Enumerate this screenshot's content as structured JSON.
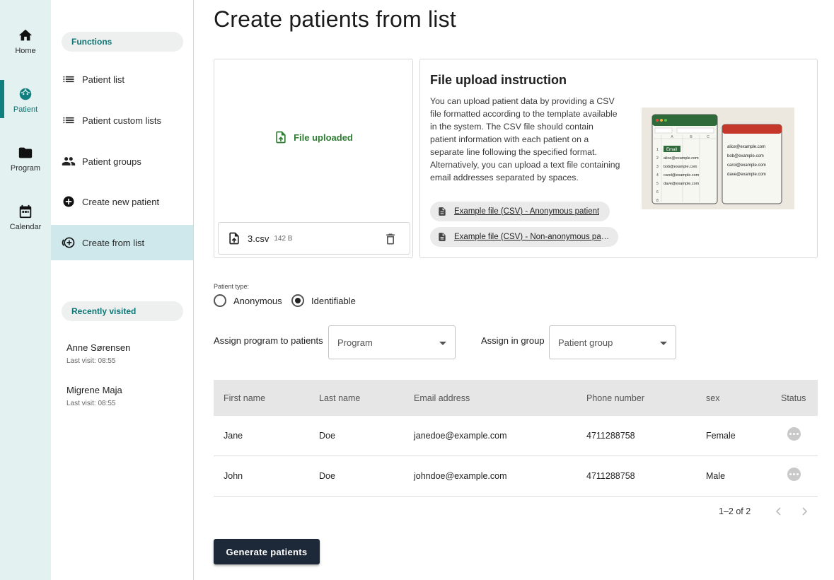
{
  "rail": [
    {
      "label": "Home",
      "icon": "home-icon"
    },
    {
      "label": "Patient",
      "icon": "face-icon"
    },
    {
      "label": "Program",
      "icon": "folder-icon"
    },
    {
      "label": "Calendar",
      "icon": "calendar-icon"
    }
  ],
  "subnav": {
    "functions_header": "Functions",
    "items": [
      {
        "label": "Patient list",
        "icon": "list-icon"
      },
      {
        "label": "Patient custom lists",
        "icon": "list-icon"
      },
      {
        "label": "Patient groups",
        "icon": "people-icon"
      },
      {
        "label": "Create new patient",
        "icon": "add-circle-icon"
      },
      {
        "label": "Create from list",
        "icon": "add-list-icon"
      }
    ],
    "recent_header": "Recently visited",
    "recent": [
      {
        "name": "Anne Sørensen",
        "time": "Last visit: 08:55"
      },
      {
        "name": "Migrene Maja",
        "time": "Last visit: 08:55"
      }
    ]
  },
  "page": {
    "title": "Create patients from list"
  },
  "upload": {
    "status": "File uploaded",
    "file_name": "3.csv",
    "file_size": "142 B"
  },
  "instructions": {
    "title": "File upload instruction",
    "text": "You can upload patient data by providing a CSV file formatted according to the template available in the system. The CSV file should contain patient information with each patient on a separate line following the specified format. Alternatively, you can upload a text file containing email addresses separated by spaces.",
    "links": [
      "Example file (CSV) - Anonymous patient",
      "Example file (CSV) - Non-anonymous patient"
    ],
    "illustration": {
      "sheet_header": "Email",
      "sheet_rows": [
        "1",
        "2",
        "3",
        "4",
        "5",
        "6",
        "8"
      ],
      "sheet_cols": [
        "A",
        "B",
        "C"
      ],
      "emails": [
        "alice@example.com",
        "bob@example.com",
        "carol@example.com",
        "dave@example.com"
      ]
    }
  },
  "form": {
    "patient_type_label": "Patient type:",
    "options": [
      "Anonymous",
      "Identifiable"
    ],
    "selected": "Identifiable",
    "program_label": "Assign program to patients",
    "program_placeholder": "Program",
    "group_label": "Assign in group",
    "group_placeholder": "Patient group"
  },
  "table": {
    "headers": [
      "First name",
      "Last name",
      "Email address",
      "Phone number",
      "sex",
      "Status"
    ],
    "rows": [
      [
        "Jane",
        "Doe",
        "janedoe@example.com",
        "4711288758",
        "Female"
      ],
      [
        "John",
        "Doe",
        "johndoe@example.com",
        "4711288758",
        "Male"
      ]
    ],
    "pagination": "1–2 of 2"
  },
  "actions": {
    "generate": "Generate patients"
  },
  "colors": {
    "accent": "#0f7f7f",
    "rail_bg": "#e3f1f1",
    "active_nav": "#cfe8ec",
    "button": "#1d2939",
    "success": "#2e7d32"
  }
}
